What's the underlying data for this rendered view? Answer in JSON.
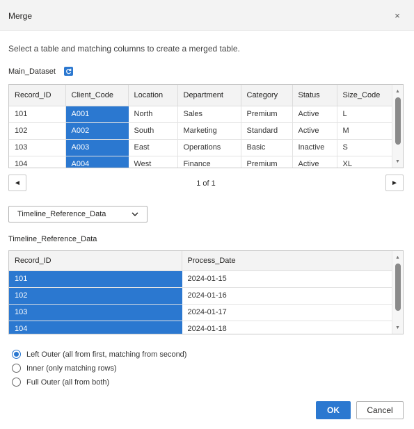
{
  "dialog": {
    "title": "Merge",
    "close_icon": "×",
    "instruction": "Select a table and matching columns to create a merged table."
  },
  "table1": {
    "name": "Main_Dataset",
    "refresh_icon": "refresh-icon",
    "columns": [
      "Record_ID",
      "Client_Code",
      "Location",
      "Department",
      "Category",
      "Status",
      "Size_Code"
    ],
    "selected_column": 1,
    "rows": [
      [
        "101",
        "A001",
        "North",
        "Sales",
        "Premium",
        "Active",
        "L"
      ],
      [
        "102",
        "A002",
        "South",
        "Marketing",
        "Standard",
        "Active",
        "M"
      ],
      [
        "103",
        "A003",
        "East",
        "Operations",
        "Basic",
        "Inactive",
        "S"
      ],
      [
        "104",
        "A004",
        "West",
        "Finance",
        "Premium",
        "Active",
        "XL"
      ]
    ]
  },
  "pager": {
    "prev": "◄",
    "next": "►",
    "text": "1 of 1"
  },
  "table_select": {
    "value": "Timeline_Reference_Data",
    "chevron": "⌄"
  },
  "table2": {
    "name": "Timeline_Reference_Data",
    "columns": [
      "Record_ID",
      "Process_Date"
    ],
    "selected_column": 0,
    "rows": [
      [
        "101",
        "2024-01-15"
      ],
      [
        "102",
        "2024-01-16"
      ],
      [
        "103",
        "2024-01-17"
      ],
      [
        "104",
        "2024-01-18"
      ]
    ]
  },
  "join_kinds": [
    {
      "label": "Left Outer (all from first, matching from second)",
      "checked": true
    },
    {
      "label": "Inner (only matching rows)",
      "checked": false
    },
    {
      "label": "Full Outer (all from both)",
      "checked": false
    }
  ],
  "buttons": {
    "ok": "OK",
    "cancel": "Cancel"
  },
  "colors": {
    "accent": "#2b78d0",
    "header_bg": "#f3f3f3"
  }
}
